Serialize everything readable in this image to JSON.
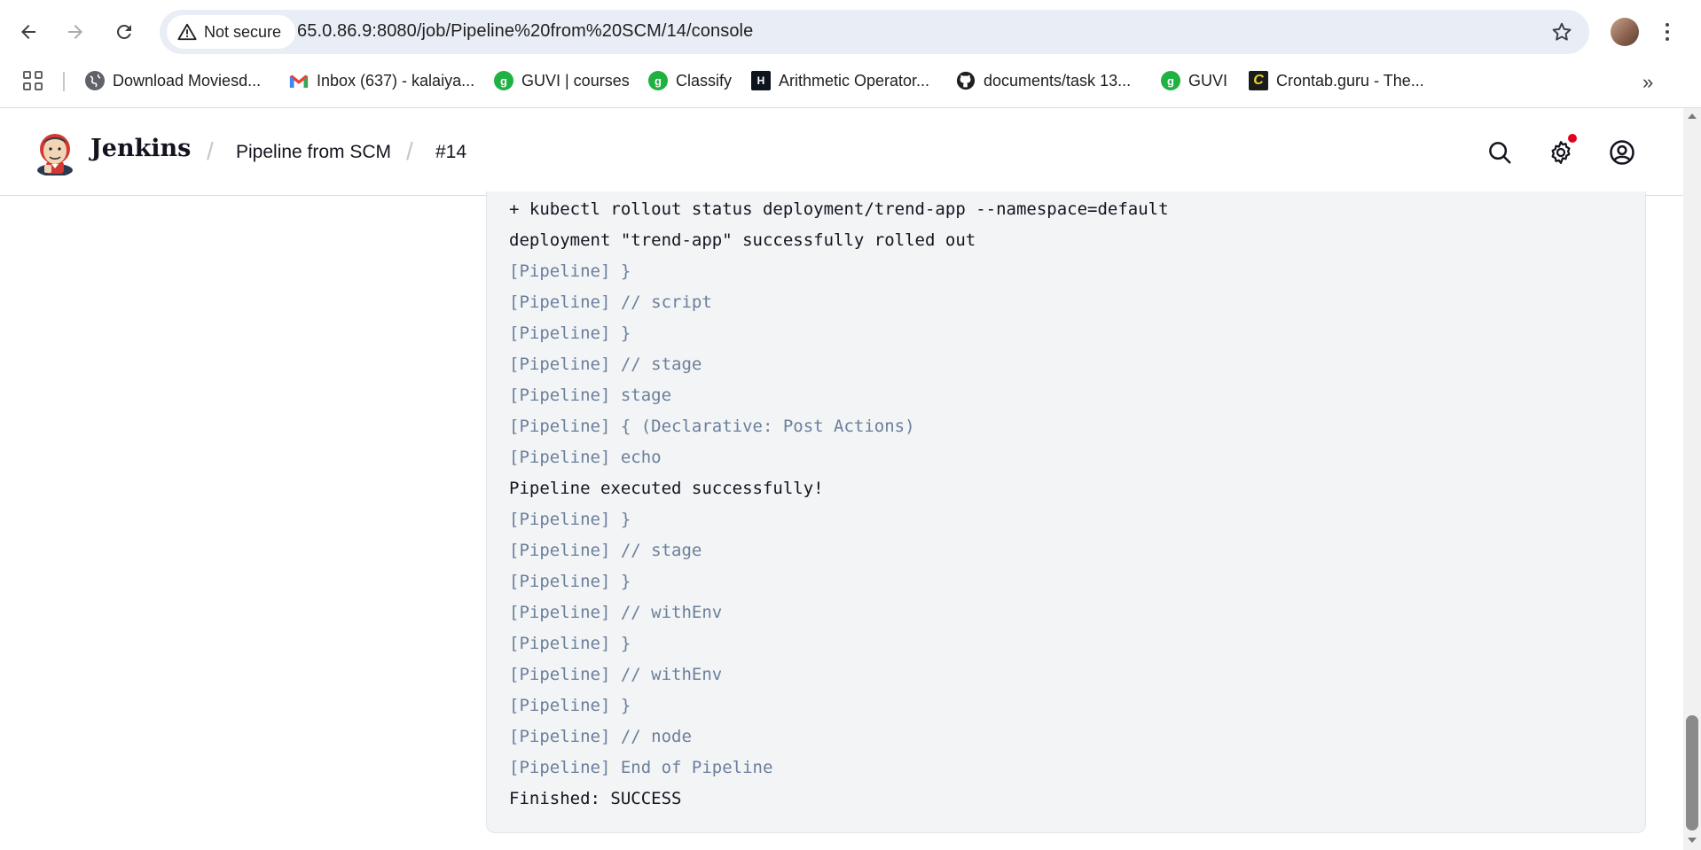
{
  "browser": {
    "security_label": "Not secure",
    "url": "65.0.86.9:8080/job/Pipeline%20from%20SCM/14/console",
    "bookmarks": [
      {
        "label": "Download Moviesd...",
        "icon": "globe-icon"
      },
      {
        "label": "Inbox (637) - kalaiya...",
        "icon": "gmail-icon"
      },
      {
        "label": "GUVI | courses",
        "icon": "guvi-icon"
      },
      {
        "label": "Classify",
        "icon": "guvi-icon"
      },
      {
        "label": "Arithmetic Operator...",
        "icon": "hackerrank-icon"
      },
      {
        "label": "documents/task 13...",
        "icon": "github-icon"
      },
      {
        "label": "GUVI",
        "icon": "guvi-icon"
      },
      {
        "label": "Crontab.guru - The...",
        "icon": "crontab-icon"
      }
    ]
  },
  "header": {
    "title": "Jenkins",
    "breadcrumbs": [
      "Pipeline from SCM",
      "#14"
    ]
  },
  "console": {
    "lines": [
      {
        "type": "output",
        "text": "+ kubectl rollout status deployment/trend-app --namespace=default"
      },
      {
        "type": "output",
        "text": "deployment \"trend-app\" successfully rolled out"
      },
      {
        "type": "pipeline",
        "text": "[Pipeline] }"
      },
      {
        "type": "pipeline",
        "text": "[Pipeline] // script"
      },
      {
        "type": "pipeline",
        "text": "[Pipeline] }"
      },
      {
        "type": "pipeline",
        "text": "[Pipeline] // stage"
      },
      {
        "type": "pipeline",
        "text": "[Pipeline] stage"
      },
      {
        "type": "pipeline",
        "text": "[Pipeline] { (Declarative: Post Actions)"
      },
      {
        "type": "pipeline",
        "text": "[Pipeline] echo"
      },
      {
        "type": "output",
        "text": "Pipeline executed successfully!"
      },
      {
        "type": "pipeline",
        "text": "[Pipeline] }"
      },
      {
        "type": "pipeline",
        "text": "[Pipeline] // stage"
      },
      {
        "type": "pipeline",
        "text": "[Pipeline] }"
      },
      {
        "type": "pipeline",
        "text": "[Pipeline] // withEnv"
      },
      {
        "type": "pipeline",
        "text": "[Pipeline] }"
      },
      {
        "type": "pipeline",
        "text": "[Pipeline] // withEnv"
      },
      {
        "type": "pipeline",
        "text": "[Pipeline] }"
      },
      {
        "type": "pipeline",
        "text": "[Pipeline] // node"
      },
      {
        "type": "pipeline",
        "text": "[Pipeline] End of Pipeline"
      },
      {
        "type": "output",
        "text": "Finished: SUCCESS"
      }
    ]
  },
  "colors": {
    "pipeline_text": "#6b7f9b",
    "output_text": "#14141f",
    "console_bg": "#f2f4f6",
    "notification_dot": "#e6001f"
  }
}
